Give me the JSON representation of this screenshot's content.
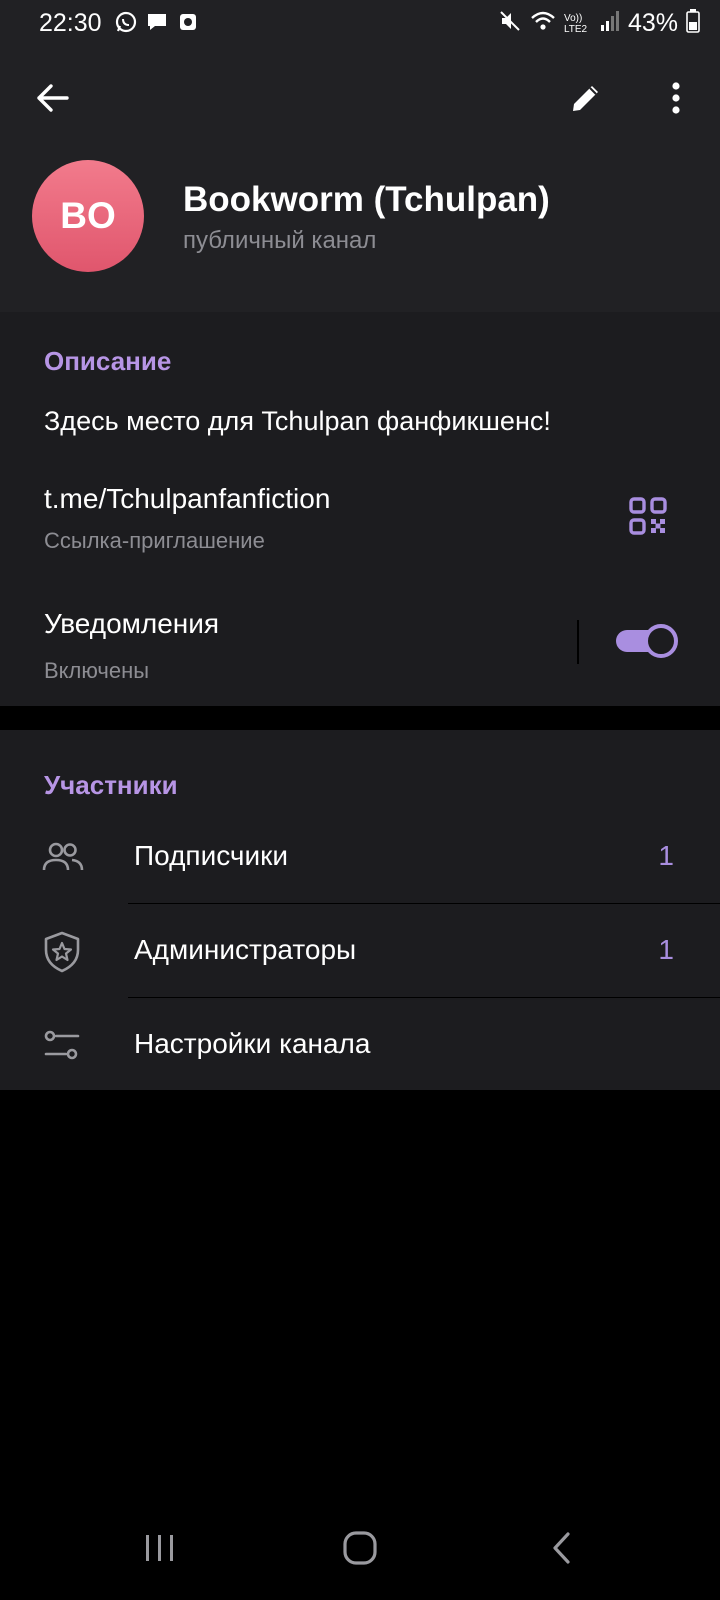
{
  "status_bar": {
    "time": "22:30",
    "battery": "43%",
    "network_label": "Vo)) LTE2",
    "icons": [
      "whatsapp-icon",
      "message-icon",
      "camera-icon",
      "mute-icon",
      "wifi-icon",
      "signal-icon",
      "battery-icon"
    ]
  },
  "header": {
    "avatar_initials": "BO",
    "title": "Bookworm (Tchulpan)",
    "subtitle": "публичный канал",
    "actions": [
      "back-arrow-icon",
      "edit-pencil-icon",
      "more-vertical-icon"
    ]
  },
  "info": {
    "section_title": "Описание",
    "description": "Здесь место для Tchulpan фанфикшенс!",
    "link": "t.me/Tchulpanfanfiction",
    "link_caption": "Ссылка-приглашение",
    "notifications_label": "Уведомления",
    "notifications_status": "Включены",
    "notifications_enabled": true
  },
  "members": {
    "section_title": "Участники",
    "rows": [
      {
        "label": "Подписчики",
        "count": "1",
        "icon": "people-icon"
      },
      {
        "label": "Администраторы",
        "count": "1",
        "icon": "shield-star-icon"
      },
      {
        "label": "Настройки канала",
        "count": "",
        "icon": "settings-sliders-icon"
      }
    ]
  },
  "colors": {
    "accent": "#b795e5",
    "toggle": "#a98ee0",
    "avatar": "#e9687d",
    "background": "#000000",
    "card": "#1c1c1f",
    "header": "#212124"
  }
}
